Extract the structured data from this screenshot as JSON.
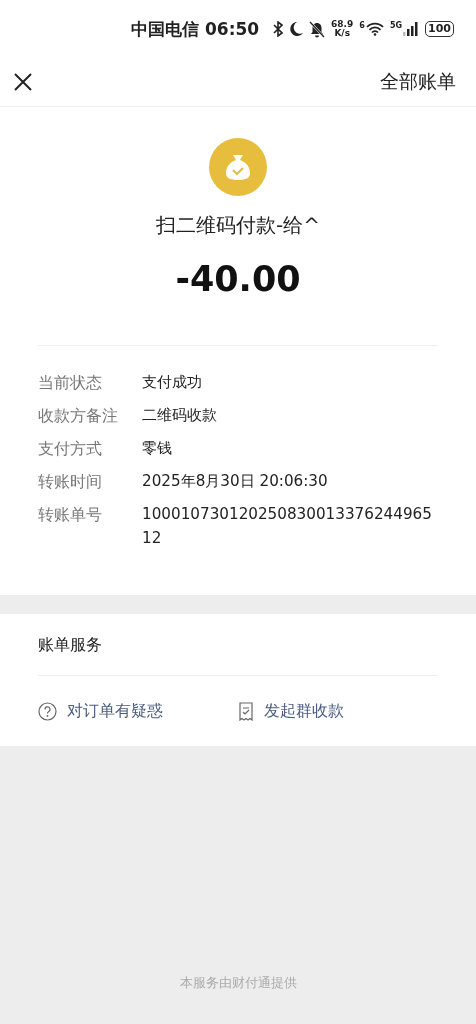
{
  "status_bar": {
    "carrier": "中国电信",
    "time": "06:50",
    "speed_value": "68.9",
    "speed_unit": "K/s",
    "wifi_tag": "6",
    "network": "5G",
    "battery": "100"
  },
  "nav": {
    "action": "全部账单"
  },
  "bill": {
    "title": "扫二维码付款-给^",
    "amount": "-40.00"
  },
  "details": [
    {
      "label": "当前状态",
      "value": "支付成功"
    },
    {
      "label": "收款方备注",
      "value": "二维码收款"
    },
    {
      "label": "支付方式",
      "value": "零钱"
    },
    {
      "label": "转账时间",
      "value": "2025年8月30日 20:06:30"
    },
    {
      "label": "转账单号",
      "value": "10001073012025083001337624496512"
    }
  ],
  "services": {
    "title": "账单服务",
    "actions": [
      {
        "kind": "question",
        "label": "对订单有疑惑"
      },
      {
        "kind": "receipt",
        "label": "发起群收款"
      }
    ]
  },
  "footer": "本服务由财付通提供"
}
